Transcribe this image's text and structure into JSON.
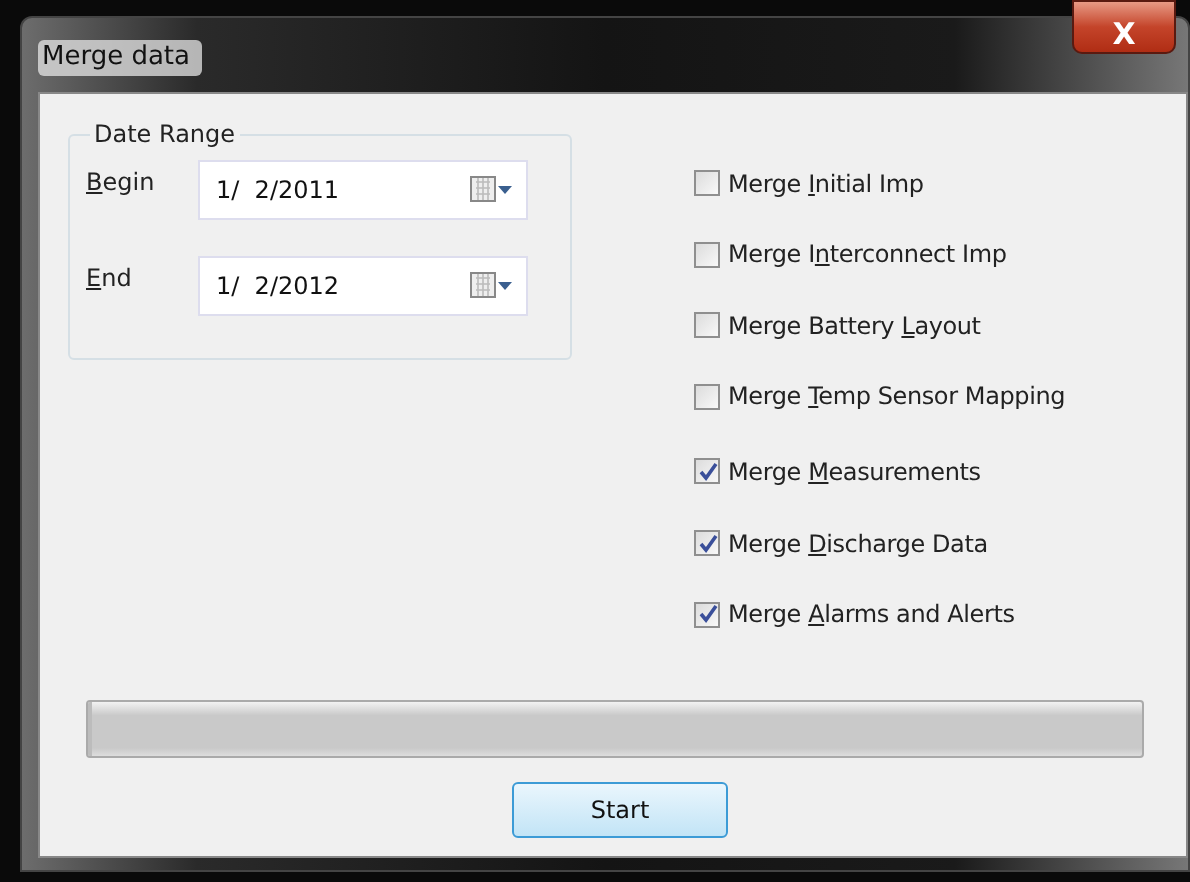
{
  "window": {
    "title": "Merge data",
    "close": "X"
  },
  "date_range": {
    "title": "Date Range",
    "fields": [
      {
        "label": {
          "key": "B",
          "rest": "egin"
        },
        "value": "1/  2/2011"
      },
      {
        "label": {
          "key": "E",
          "rest": "nd"
        },
        "value": "1/  2/2012"
      }
    ]
  },
  "options": [
    {
      "label": {
        "before": "Merge ",
        "key": "I",
        "after": "nitial Imp"
      },
      "checked": false
    },
    {
      "label": {
        "before": "Merge I",
        "key": "n",
        "after": "terconnect Imp"
      },
      "checked": false
    },
    {
      "label": {
        "before": "Merge Battery ",
        "key": "L",
        "after": "ayout"
      },
      "checked": false
    },
    {
      "label": {
        "before": "Merge ",
        "key": "T",
        "after": "emp Sensor Mapping"
      },
      "checked": false
    },
    {
      "label": {
        "before": "Merge ",
        "key": "M",
        "after": "easurements"
      },
      "checked": true
    },
    {
      "label": {
        "before": "Merge ",
        "key": "D",
        "after": "ischarge Data"
      },
      "checked": true
    },
    {
      "label": {
        "before": "Merge ",
        "key": "A",
        "after": "larms and Alerts"
      },
      "checked": true
    }
  ],
  "progress": {
    "level": 0
  },
  "start_button": "Start"
}
